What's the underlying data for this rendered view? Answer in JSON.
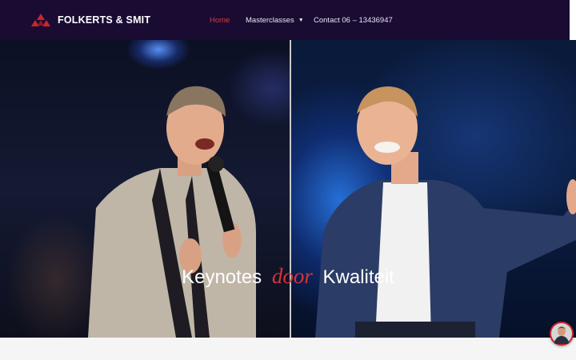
{
  "brand": {
    "name": "FOLKERTS & SMIT",
    "logo_icon": "three-triangles-logo",
    "accent_color": "#d83b3b"
  },
  "nav": {
    "home": "Home",
    "masterclasses": "Masterclasses",
    "contact": "Contact 06 – 13436947",
    "active": "Home"
  },
  "hero": {
    "title_before": "Keynotes",
    "title_accent": "door",
    "title_after": "Kwaliteit"
  },
  "colors": {
    "header_bg": "#1a0b33",
    "accent": "#d8343a"
  },
  "chat": {
    "icon": "chat-avatar-icon"
  }
}
